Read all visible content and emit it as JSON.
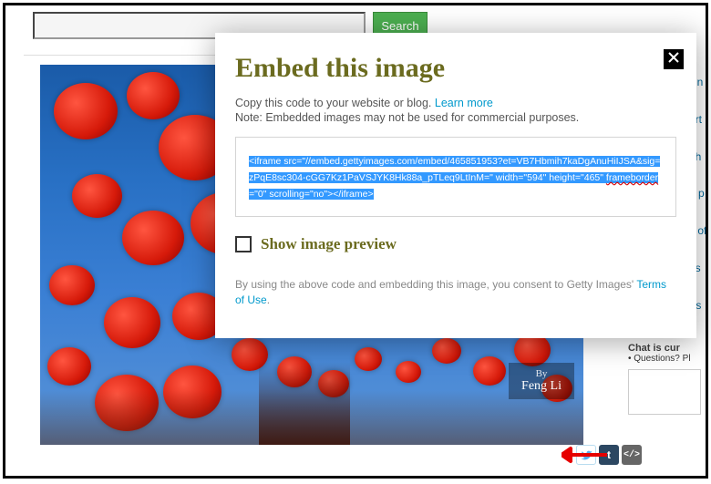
{
  "search": {
    "placeholder": "",
    "button": "Search"
  },
  "modal": {
    "title": "Embed this image",
    "copy_text": "Copy this code to your website or blog.",
    "learn_more": "Learn more",
    "note": "Note: Embedded images may not be used for commercial purposes.",
    "code_part1": "<iframe src=\"//embed.gettyimages.com/embed/465851953?et=VB7Hbmih7kaDgAnuHiIJSA&sig=zPqE8sc304-cGG7Kz1PaVSJYK8Hk88a_pTLeq9LtInM=\" width=\"594\" height=\"465\" ",
    "code_fb": "frameborder",
    "code_part2": "=\"0\" scrolling=\"no\"></iframe>",
    "preview_label": "Show image preview",
    "consent_text": "By using the above code and embedding this image, you consent to Getty Images' ",
    "terms": "Terms of Use",
    "dot": "."
  },
  "image": {
    "credit_by": "By",
    "credit_name": "Feng Li"
  },
  "sidebar": {
    "links": [
      "cin",
      "art",
      "gh",
      "d p",
      "s of",
      "es",
      "r s"
    ],
    "chat_title": "Chat is cur",
    "chat_question": "Questions? Pl"
  },
  "share": {
    "embed_label": "</>"
  }
}
